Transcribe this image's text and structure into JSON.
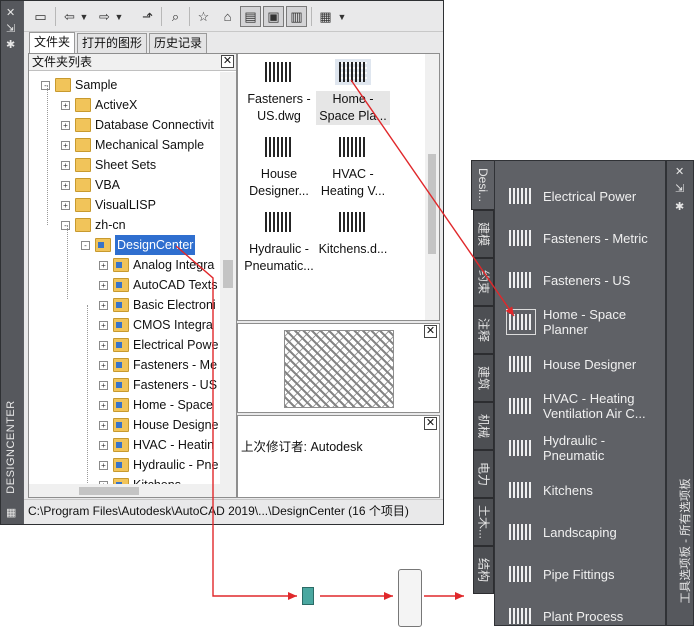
{
  "design_center": {
    "vertical_title": "DESIGNCENTER",
    "tabs": [
      {
        "label": "文件夹",
        "active": true
      },
      {
        "label": "打开的图形",
        "active": false
      },
      {
        "label": "历史记录",
        "active": false
      }
    ],
    "tree": {
      "header": "文件夹列表",
      "rows": [
        {
          "label": "Sample",
          "level": 0,
          "expand": "-",
          "cad": false
        },
        {
          "label": "ActiveX",
          "level": 1,
          "expand": "+",
          "cad": false
        },
        {
          "label": "Database Connectivit",
          "level": 1,
          "expand": "+",
          "cad": false
        },
        {
          "label": "Mechanical Sample",
          "level": 1,
          "expand": "+",
          "cad": false
        },
        {
          "label": "Sheet Sets",
          "level": 1,
          "expand": "+",
          "cad": false
        },
        {
          "label": "VBA",
          "level": 1,
          "expand": "+",
          "cad": false
        },
        {
          "label": "VisualLISP",
          "level": 1,
          "expand": "+",
          "cad": false
        },
        {
          "label": "zh-cn",
          "level": 1,
          "expand": "-",
          "cad": false
        },
        {
          "label": "DesignCenter",
          "level": 2,
          "expand": "-",
          "cad": true,
          "selected": true
        },
        {
          "label": "Analog Integra",
          "level": 3,
          "expand": "+",
          "cad": true
        },
        {
          "label": "AutoCAD Texts",
          "level": 3,
          "expand": "+",
          "cad": true
        },
        {
          "label": "Basic Electroni",
          "level": 3,
          "expand": "+",
          "cad": true
        },
        {
          "label": "CMOS Integra",
          "level": 3,
          "expand": "+",
          "cad": true
        },
        {
          "label": "Electrical Powe",
          "level": 3,
          "expand": "+",
          "cad": true
        },
        {
          "label": "Fasteners - Me",
          "level": 3,
          "expand": "+",
          "cad": true
        },
        {
          "label": "Fasteners - US",
          "level": 3,
          "expand": "+",
          "cad": true
        },
        {
          "label": "Home - Space",
          "level": 3,
          "expand": "+",
          "cad": true
        },
        {
          "label": "House Designe",
          "level": 3,
          "expand": "+",
          "cad": true
        },
        {
          "label": "HVAC - Heatin",
          "level": 3,
          "expand": "+",
          "cad": true
        },
        {
          "label": "Hydraulic - Pne",
          "level": 3,
          "expand": "+",
          "cad": true
        },
        {
          "label": "Kitchens",
          "level": 3,
          "expand": "+",
          "cad": true
        }
      ]
    },
    "thumbnails": [
      {
        "line1": "Fasteners -",
        "line2": "US.dwg",
        "selected": false
      },
      {
        "line1": "Home -",
        "line2": "Space Pla...",
        "selected": true
      },
      {
        "line1": "House",
        "line2": "Designer...",
        "selected": false
      },
      {
        "line1": "HVAC -",
        "line2": "Heating V...",
        "selected": false
      },
      {
        "line1": "Hydraulic -",
        "line2": "Pneumatic...",
        "selected": false
      },
      {
        "line1": "Kitchens.d...",
        "line2": "",
        "selected": false
      }
    ],
    "description": "上次修订者: Autodesk",
    "status": "C:\\Program Files\\Autodesk\\AutoCAD 2019\\...\\DesignCenter (16 个项目)"
  },
  "tool_palettes": {
    "side_title": "工具选项板 - 所有选项板",
    "tabs": [
      "Desi...",
      "建模",
      "约束",
      "注释",
      "建筑",
      "机械",
      "电力",
      "土木...",
      "结构"
    ],
    "items": [
      "Electrical Power",
      "Fasteners - Metric",
      "Fasteners - US",
      "Home - Space Planner",
      "House Designer",
      "HVAC - Heating Ventilation Air C...",
      "Hydraulic - Pneumatic",
      "Kitchens",
      "Landscaping",
      "Pipe Fittings",
      "Plant Process"
    ]
  },
  "colors": {
    "selection": "#2f6fcf",
    "arrow": "#e0282b",
    "palette_bg": "#5f6166"
  }
}
